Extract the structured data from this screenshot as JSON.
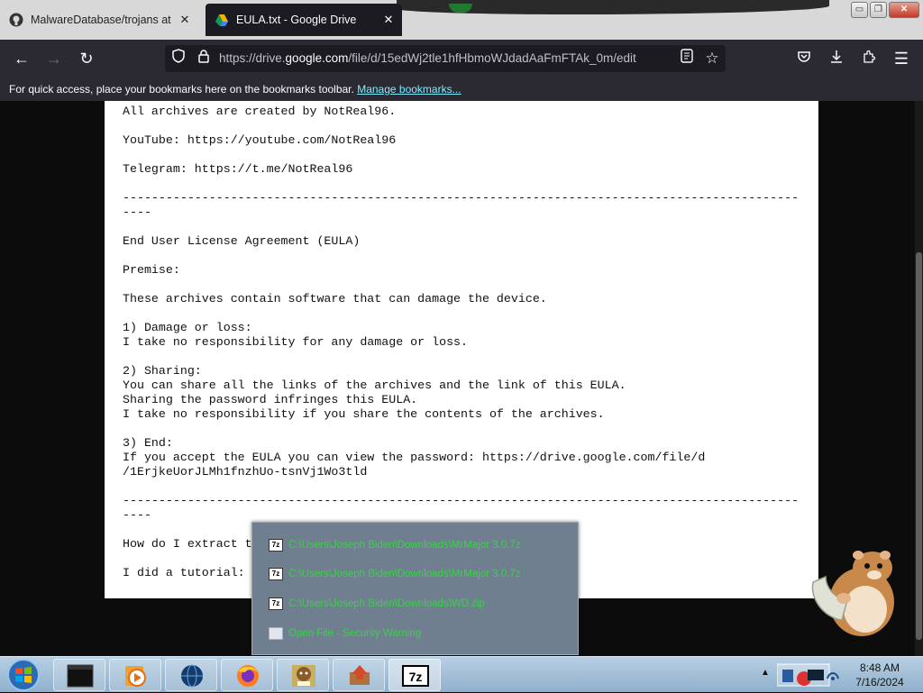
{
  "tabs": [
    {
      "label": "MalwareDatabase/trojans at ma",
      "icon": "github-icon",
      "active": false
    },
    {
      "label": "EULA.txt - Google Drive",
      "icon": "google-drive-icon",
      "active": true
    }
  ],
  "window_controls": {
    "minimize": "▭",
    "restore": "❐",
    "close": "✕"
  },
  "nav": {
    "back": "←",
    "forward": "→",
    "reload": "↻",
    "url_prefix": "https://drive.",
    "url_domain": "google.com",
    "url_suffix": "/file/d/15edWj2tle1hfHbmoWJdadAaFmFTAk_0m/edit"
  },
  "bookmarks_bar": {
    "text": "For quick access, place your bookmarks here on the bookmarks toolbar.",
    "link": "Manage bookmarks..."
  },
  "document": {
    "lines": [
      "All archives are created by NotReal96.",
      "",
      "YouTube: https://youtube.com/NotReal96",
      "",
      "Telegram: https://t.me/NotReal96",
      "",
      "----------------------------------------------------------------------------------------------",
      "----",
      "",
      "End User License Agreement (EULA)",
      "",
      "Premise:",
      "",
      "These archives contain software that can damage the device.",
      "",
      "1) Damage or loss:",
      "I take no responsibility for any damage or loss.",
      "",
      "2) Sharing:",
      "You can share all the links of the archives and the link of this EULA.",
      "Sharing the password infringes this EULA.",
      "I take no responsibility if you share the contents of the archives.",
      "",
      "3) End:",
      "If you accept the EULA you can view the password: https://drive.google.com/file/d",
      "/1ErjkeUorJLMh1fnzhUo-tsnVj1Wo3tld",
      "",
      "----------------------------------------------------------------------------------------------",
      "----",
      "",
      "How do I extract t",
      "",
      "I did a tutorial:"
    ]
  },
  "jumplist": {
    "items": [
      {
        "label": "C:\\Users\\Joseph Biden\\Downloads\\MrMajor 3.0.7z",
        "icon": "7z-archive-icon"
      },
      {
        "label": "C:\\Users\\Joseph Biden\\Downloads\\MrMajor 3.0.7z",
        "icon": "7z-archive-icon"
      },
      {
        "label": "C:\\Users\\Joseph Biden\\Downloads\\WD.zip",
        "icon": "7z-archive-icon"
      },
      {
        "label": "Open File - Security Warning",
        "icon": "window-icon"
      }
    ]
  },
  "taskbar": {
    "items": [
      "terminal-icon",
      "media-player-icon",
      "globe-icon",
      "firefox-icon",
      "bonzi-box-icon",
      "installer-icon",
      "7zip-icon"
    ],
    "clock_time": "8:48 AM",
    "clock_date": "7/16/2024"
  },
  "colors": {
    "accent_link": "#80ebff",
    "jumplist_text": "#3bd04a",
    "tab_active": "#1c1b22",
    "toolbar": "#2b2a33"
  }
}
